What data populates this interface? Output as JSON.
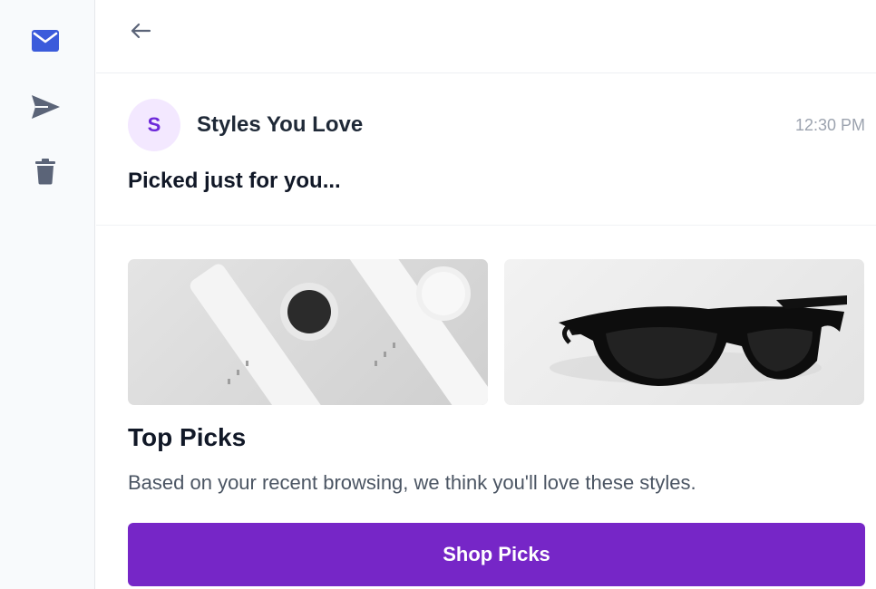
{
  "sidebar": {
    "items": [
      {
        "icon": "mail-icon",
        "active": true
      },
      {
        "icon": "send-icon",
        "active": false
      },
      {
        "icon": "trash-icon",
        "active": false
      }
    ]
  },
  "email": {
    "avatar_initial": "S",
    "sender": "Styles You Love",
    "time": "12:30 PM",
    "subject": "Picked just for you..."
  },
  "promo": {
    "title": "Top Picks",
    "text": "Based on your recent browsing, we think you'll love these styles.",
    "cta_label": "Shop Picks"
  },
  "colors": {
    "accent": "#7626c7",
    "active_icon": "#3b5bdb",
    "inactive_icon": "#5b6478",
    "avatar_bg": "#f3e8ff",
    "avatar_text": "#6d28d9"
  }
}
